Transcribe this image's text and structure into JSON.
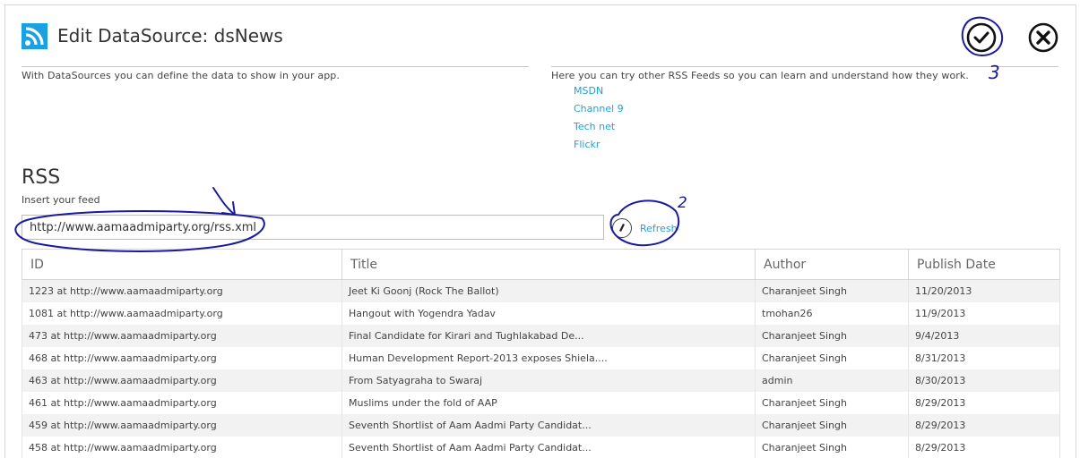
{
  "header": {
    "title": "Edit DataSource: dsNews",
    "icon": "rss-icon",
    "accent": "#1ba1e2",
    "save_icon": "check-icon",
    "close_icon": "close-icon"
  },
  "left_desc": "With DataSources you can define the data to show in your app.",
  "right_desc": "Here you can try other RSS Feeds so you can learn and understand how they work.",
  "feeds": [
    "MSDN",
    "Channel 9",
    "Tech net",
    "Flickr"
  ],
  "rss": {
    "heading": "RSS",
    "insert_label": "Insert your feed",
    "feed_url": "http://www.aamaadmiparty.org/rss.xml",
    "refresh_label": "Refresh"
  },
  "table": {
    "columns": [
      "ID",
      "Title",
      "Author",
      "Publish Date"
    ],
    "rows": [
      [
        "1223 at http://www.aamaadmiparty.org",
        "Jeet Ki Goonj (Rock The Ballot)",
        "Charanjeet Singh",
        "11/20/2013"
      ],
      [
        "1081 at http://www.aamaadmiparty.org",
        "Hangout with Yogendra Yadav",
        "tmohan26",
        "11/9/2013"
      ],
      [
        "473 at http://www.aamaadmiparty.org",
        "Final Candidate for Kirari and Tughlakabad De...",
        "Charanjeet Singh",
        "9/4/2013"
      ],
      [
        "468 at http://www.aamaadmiparty.org",
        "Human Development Report-2013 exposes Shiela....",
        "Charanjeet Singh",
        "8/31/2013"
      ],
      [
        "463 at http://www.aamaadmiparty.org",
        "From Satyagraha to Swaraj",
        "admin",
        "8/30/2013"
      ],
      [
        "461 at http://www.aamaadmiparty.org",
        "Muslims under the fold of AAP",
        "Charanjeet Singh",
        "8/29/2013"
      ],
      [
        "459 at http://www.aamaadmiparty.org",
        "Seventh Shortlist of Aam Aadmi Party Candidat...",
        "Charanjeet Singh",
        "8/29/2013"
      ],
      [
        "458 at http://www.aamaadmiparty.org",
        "Seventh Shortlist of Aam Aadmi Party Candidat...",
        "Charanjeet Singh",
        "8/29/2013"
      ]
    ]
  },
  "annotations": {
    "marker_2": "2",
    "marker_3": "3",
    "ink_color": "#1a1aa0"
  }
}
